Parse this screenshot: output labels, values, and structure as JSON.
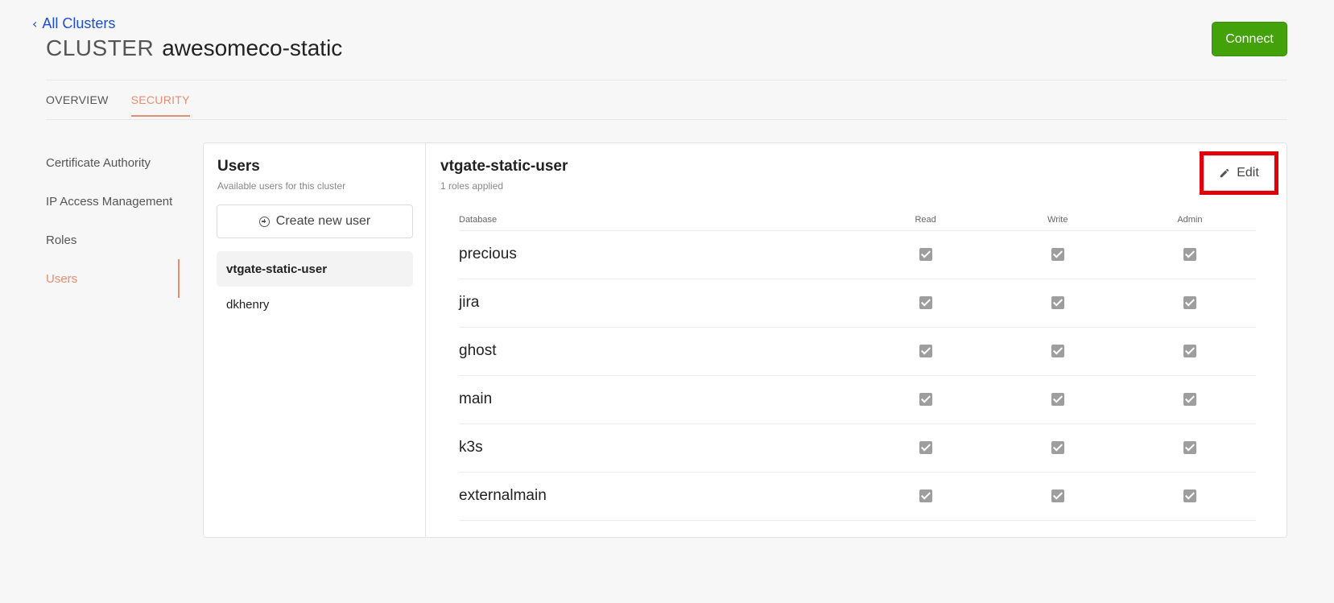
{
  "header": {
    "back_label": "All Clusters",
    "title_prefix": "CLUSTER",
    "cluster_name": "awesomeco-static",
    "connect_label": "Connect"
  },
  "tabs": [
    {
      "label": "OVERVIEW",
      "active": false
    },
    {
      "label": "SECURITY",
      "active": true
    }
  ],
  "sidebar": {
    "items": [
      {
        "label": "Certificate Authority",
        "active": false
      },
      {
        "label": "IP Access Management",
        "active": false
      },
      {
        "label": "Roles",
        "active": false
      },
      {
        "label": "Users",
        "active": true
      }
    ]
  },
  "users_panel": {
    "title": "Users",
    "subtitle": "Available users for this cluster",
    "create_label": "Create new user",
    "users": [
      {
        "name": "vtgate-static-user",
        "selected": true
      },
      {
        "name": "dkhenry",
        "selected": false
      }
    ]
  },
  "detail": {
    "title": "vtgate-static-user",
    "subtitle": "1 roles applied",
    "edit_label": "Edit",
    "columns": {
      "database": "Database",
      "read": "Read",
      "write": "Write",
      "admin": "Admin"
    },
    "rows": [
      {
        "db": "precious",
        "read": true,
        "write": true,
        "admin": true
      },
      {
        "db": "jira",
        "read": true,
        "write": true,
        "admin": true
      },
      {
        "db": "ghost",
        "read": true,
        "write": true,
        "admin": true
      },
      {
        "db": "main",
        "read": true,
        "write": true,
        "admin": true
      },
      {
        "db": "k3s",
        "read": true,
        "write": true,
        "admin": true
      },
      {
        "db": "externalmain",
        "read": true,
        "write": true,
        "admin": true
      }
    ]
  },
  "colors": {
    "accent": "#e98d72",
    "link": "#1d4ed8",
    "connect": "#43a10a",
    "highlight": "#e0000a",
    "checkbox": "#9e9e9e"
  }
}
